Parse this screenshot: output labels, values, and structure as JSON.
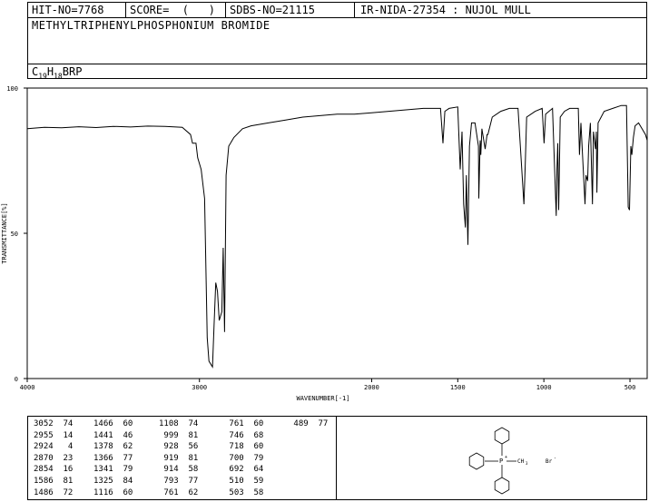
{
  "header": {
    "hit_no": "HIT-NO=7768",
    "score": "SCORE=  (   )",
    "sdbs_no": "SDBS-NO=21115",
    "ir_nida": "IR-NIDA-27354 : NUJOL MULL",
    "compound_name": "METHYLTRIPHENYLPHOSPHONIUM BROMIDE",
    "formula_c": "C",
    "formula_c_sub": "19",
    "formula_h": "H",
    "formula_h_sub": "18",
    "formula_rest": "BRP"
  },
  "chart_data": {
    "type": "line",
    "xlabel": "WAVENUMBER[-1]",
    "ylabel": "TRANSMITTANCE[%]",
    "xlim": [
      4000,
      400
    ],
    "ylim": [
      0,
      100
    ],
    "x_ticks": [
      4000,
      3000,
      2000,
      1500,
      1000,
      500
    ],
    "y_ticks": [
      0,
      50,
      100
    ],
    "series": [
      {
        "points": [
          [
            4000,
            86
          ],
          [
            3900,
            86.5
          ],
          [
            3800,
            86.3
          ],
          [
            3700,
            86.7
          ],
          [
            3600,
            86.4
          ],
          [
            3500,
            86.8
          ],
          [
            3400,
            86.6
          ],
          [
            3300,
            86.9
          ],
          [
            3200,
            86.8
          ],
          [
            3100,
            86.5
          ],
          [
            3052,
            84
          ],
          [
            3040,
            81
          ],
          [
            3020,
            81
          ],
          [
            3010,
            76
          ],
          [
            2990,
            72
          ],
          [
            2970,
            62
          ],
          [
            2955,
            14
          ],
          [
            2945,
            6
          ],
          [
            2935,
            5
          ],
          [
            2924,
            4
          ],
          [
            2915,
            18
          ],
          [
            2905,
            33
          ],
          [
            2895,
            30
          ],
          [
            2885,
            20
          ],
          [
            2870,
            23
          ],
          [
            2862,
            45
          ],
          [
            2854,
            16
          ],
          [
            2845,
            70
          ],
          [
            2830,
            80
          ],
          [
            2800,
            83
          ],
          [
            2750,
            86
          ],
          [
            2700,
            87
          ],
          [
            2600,
            88
          ],
          [
            2500,
            89
          ],
          [
            2400,
            90
          ],
          [
            2300,
            90.5
          ],
          [
            2200,
            91
          ],
          [
            2100,
            91
          ],
          [
            2000,
            91.5
          ],
          [
            1900,
            92
          ],
          [
            1800,
            92.5
          ],
          [
            1700,
            93
          ],
          [
            1650,
            93
          ],
          [
            1600,
            93
          ],
          [
            1586,
            81
          ],
          [
            1575,
            92
          ],
          [
            1550,
            93
          ],
          [
            1500,
            93.5
          ],
          [
            1486,
            72
          ],
          [
            1475,
            85
          ],
          [
            1466,
            60
          ],
          [
            1456,
            52
          ],
          [
            1450,
            70
          ],
          [
            1441,
            46
          ],
          [
            1432,
            80
          ],
          [
            1420,
            88
          ],
          [
            1400,
            88
          ],
          [
            1380,
            80
          ],
          [
            1378,
            62
          ],
          [
            1370,
            82
          ],
          [
            1366,
            77
          ],
          [
            1360,
            86
          ],
          [
            1341,
            79
          ],
          [
            1330,
            84
          ],
          [
            1325,
            84
          ],
          [
            1300,
            90
          ],
          [
            1250,
            92
          ],
          [
            1200,
            93
          ],
          [
            1150,
            93
          ],
          [
            1116,
            60
          ],
          [
            1108,
            74
          ],
          [
            1100,
            90
          ],
          [
            1050,
            92
          ],
          [
            1010,
            93
          ],
          [
            999,
            81
          ],
          [
            990,
            91
          ],
          [
            950,
            93
          ],
          [
            928,
            56
          ],
          [
            924,
            72
          ],
          [
            919,
            81
          ],
          [
            914,
            58
          ],
          [
            905,
            90
          ],
          [
            880,
            92
          ],
          [
            850,
            93
          ],
          [
            800,
            93
          ],
          [
            793,
            77
          ],
          [
            785,
            88
          ],
          [
            761,
            60
          ],
          [
            755,
            70
          ],
          [
            746,
            68
          ],
          [
            740,
            80
          ],
          [
            730,
            88
          ],
          [
            718,
            60
          ],
          [
            712,
            85
          ],
          [
            700,
            79
          ],
          [
            695,
            85
          ],
          [
            692,
            64
          ],
          [
            685,
            88
          ],
          [
            650,
            92
          ],
          [
            600,
            93
          ],
          [
            550,
            94
          ],
          [
            520,
            94
          ],
          [
            510,
            59
          ],
          [
            503,
            58
          ],
          [
            495,
            80
          ],
          [
            489,
            77
          ],
          [
            480,
            83
          ],
          [
            470,
            87
          ],
          [
            450,
            88
          ],
          [
            430,
            86
          ],
          [
            410,
            84
          ],
          [
            400,
            82
          ]
        ]
      }
    ],
    "peak_table": [
      {
        "wn": 3052,
        "t": 74
      },
      {
        "wn": 2955,
        "t": 14
      },
      {
        "wn": 2924,
        "t": 4
      },
      {
        "wn": 2870,
        "t": 23
      },
      {
        "wn": 2854,
        "t": 16
      },
      {
        "wn": 1586,
        "t": 81
      },
      {
        "wn": 1486,
        "t": 72
      },
      {
        "wn": 1466,
        "t": 60
      },
      {
        "wn": 1441,
        "t": 46
      },
      {
        "wn": 1378,
        "t": 62
      },
      {
        "wn": 1366,
        "t": 77
      },
      {
        "wn": 1341,
        "t": 79
      },
      {
        "wn": 1325,
        "t": 84
      },
      {
        "wn": 1116,
        "t": 60
      },
      {
        "wn": 1108,
        "t": 74
      },
      {
        "wn": 999,
        "t": 81
      },
      {
        "wn": 928,
        "t": 56
      },
      {
        "wn": 919,
        "t": 81
      },
      {
        "wn": 914,
        "t": 58
      },
      {
        "wn": 793,
        "t": 77
      },
      {
        "wn": 761,
        "t": 62
      },
      {
        "wn": 761,
        "t": 60
      },
      {
        "wn": 746,
        "t": 68
      },
      {
        "wn": 718,
        "t": 60
      },
      {
        "wn": 700,
        "t": 79
      },
      {
        "wn": 692,
        "t": 64
      },
      {
        "wn": 510,
        "t": 59
      },
      {
        "wn": 503,
        "t": 58
      },
      {
        "wn": 489,
        "t": 77
      }
    ]
  },
  "structure": {
    "cation_label": "P",
    "charge": "+",
    "methyl": "CH",
    "methyl_sub": "3",
    "anion": "Br",
    "anion_charge": "-"
  },
  "colors": {
    "line": "#000000",
    "background": "#ffffff"
  }
}
